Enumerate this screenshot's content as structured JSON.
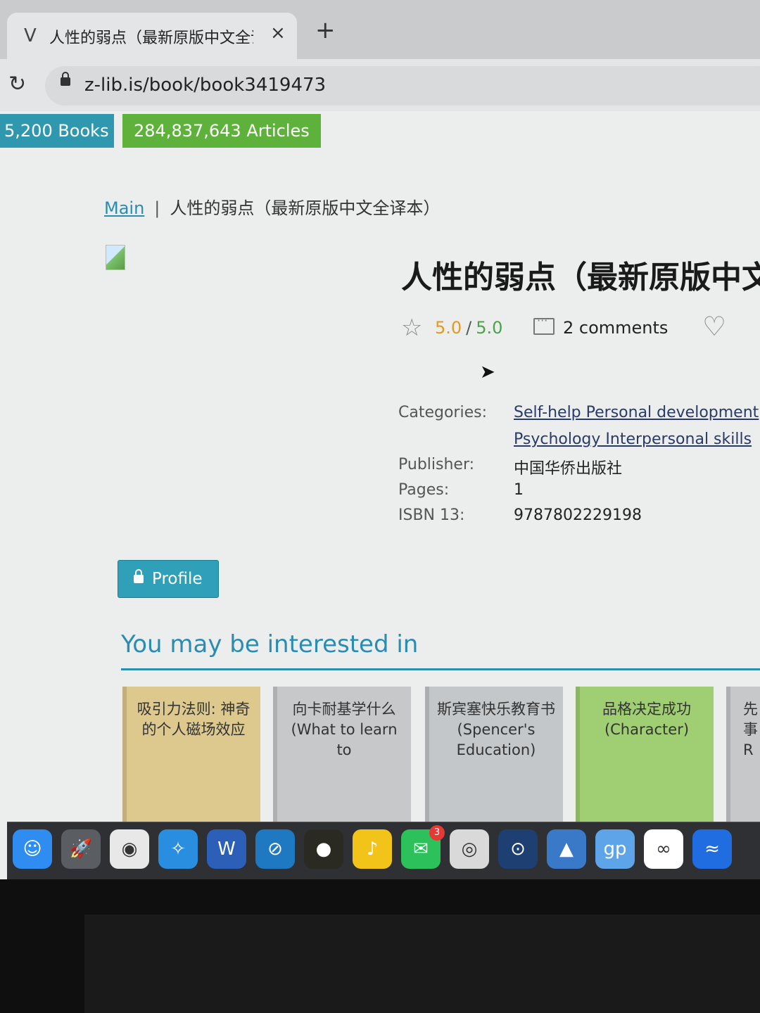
{
  "browser": {
    "tab_favicon": "Ⅴ",
    "tab_title": "人性的弱点（最新原版中文全译",
    "tab_close": "×",
    "new_tab": "+",
    "url": "z-lib.is/book/book3419473"
  },
  "stats": {
    "books": "5,200 Books",
    "articles": "284,837,643 Articles"
  },
  "breadcrumb": {
    "home": "Main",
    "separator": "|",
    "current": "人性的弱点（最新原版中文全译本）"
  },
  "book": {
    "title": "人性的弱点（最新原版中文全译本）",
    "rating": "5.0",
    "rating_max": "5.0",
    "rating_separator": "/",
    "comments": "2 comments",
    "details": {
      "categories_label": "Categories:",
      "category_1": "Self-help Personal development",
      "category_2": "Psychology Interpersonal skills",
      "publisher_label": "Publisher:",
      "publisher": "中国华侨出版社",
      "pages_label": "Pages:",
      "pages": "1",
      "isbn_label": "ISBN 13:",
      "isbn": "9787802229198"
    }
  },
  "profile_button": "Profile",
  "interested": {
    "title": "You may be interested in",
    "cards": [
      {
        "text": "吸引力法则: 神奇的个人磁场效应",
        "color": "#ddc88e"
      },
      {
        "text": "向卡耐基学什么 (What to learn to",
        "color": "#c6c8c9"
      },
      {
        "text": "斯宾塞快乐教育书 (Spencer's Education)",
        "color": "#c3c7ca"
      },
      {
        "text": "品格决定成功 (Character)",
        "color": "#9fcf72"
      },
      {
        "text": "先事R",
        "color": "#c6c8c9"
      }
    ]
  },
  "dock": {
    "icons": [
      {
        "name": "finder-icon",
        "color": "#2f8cf0"
      },
      {
        "name": "launchpad-icon",
        "color": "#5a5d62"
      },
      {
        "name": "chrome-icon",
        "color": "#e8e8e8"
      },
      {
        "name": "safari-icon",
        "color": "#2a8ee0"
      },
      {
        "name": "word-icon",
        "color": "#2b5fb8"
      },
      {
        "name": "app-icon",
        "color": "#1e78c2"
      },
      {
        "name": "music-disc-icon",
        "color": "#2b2a22"
      },
      {
        "name": "qq-music-icon",
        "color": "#f2c318"
      },
      {
        "name": "wechat-icon",
        "color": "#2cc15a"
      },
      {
        "name": "disk-utility-icon",
        "color": "#d9d9d9"
      },
      {
        "name": "app-icon-blue",
        "color": "#1d3f72"
      },
      {
        "name": "xcode-icon",
        "color": "#3a78c8"
      },
      {
        "name": "gp-icon",
        "color": "#5ea4e8"
      },
      {
        "name": "baidu-netdisk-icon",
        "color": "#ffffff"
      },
      {
        "name": "app-icon-wave",
        "color": "#1f6de0"
      }
    ],
    "wechat_badge": "3"
  }
}
